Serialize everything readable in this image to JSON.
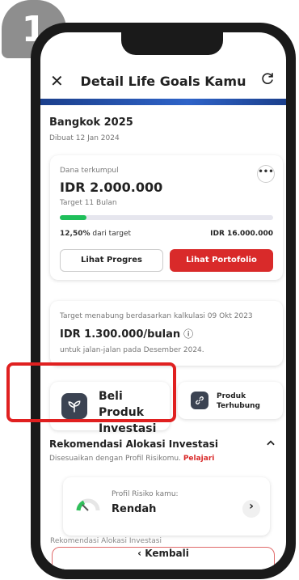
{
  "step_badge": "1",
  "header": {
    "title": "Detail Life Goals Kamu"
  },
  "goal": {
    "name": "Bangkok 2025",
    "created": "Dibuat 12 Jan 2024"
  },
  "fund_card": {
    "label": "Dana terkumpul",
    "amount": "IDR 2.000.000",
    "target_period": "Target 11 Bulan",
    "progress_fraction": 0.125,
    "progress_percent": "12,50%",
    "progress_suffix": "dari target",
    "target_value": "IDR 16.000.000",
    "btn_progress": "Lihat Progres",
    "btn_portfolio": "Lihat Portofolio"
  },
  "saving_card": {
    "line1": "Target menabung berdasarkan kalkulasi 09 Okt 2023",
    "amount": "IDR 1.300.000/bulan",
    "line3": "untuk jalan-jalan pada Desember 2024."
  },
  "actions": {
    "buy_label": "Beli Produk Investasi",
    "linked_label": "Produk Terhubung"
  },
  "recommendation": {
    "title": "Rekomendasi Alokasi Investasi",
    "subtitle": "Disesuaikan dengan Profil Risikomu.",
    "link": "Pelajari",
    "profile_label": "Profil Risiko kamu:",
    "profile_value": "Rendah",
    "peek": "Rekomendasi Alokasi Investasi"
  },
  "footer": {
    "back_label": "Kembali"
  },
  "colors": {
    "accent": "#d92a2a",
    "progress": "#1fbf5a",
    "band": "#1b3f8c",
    "highlight": "#e02020"
  }
}
